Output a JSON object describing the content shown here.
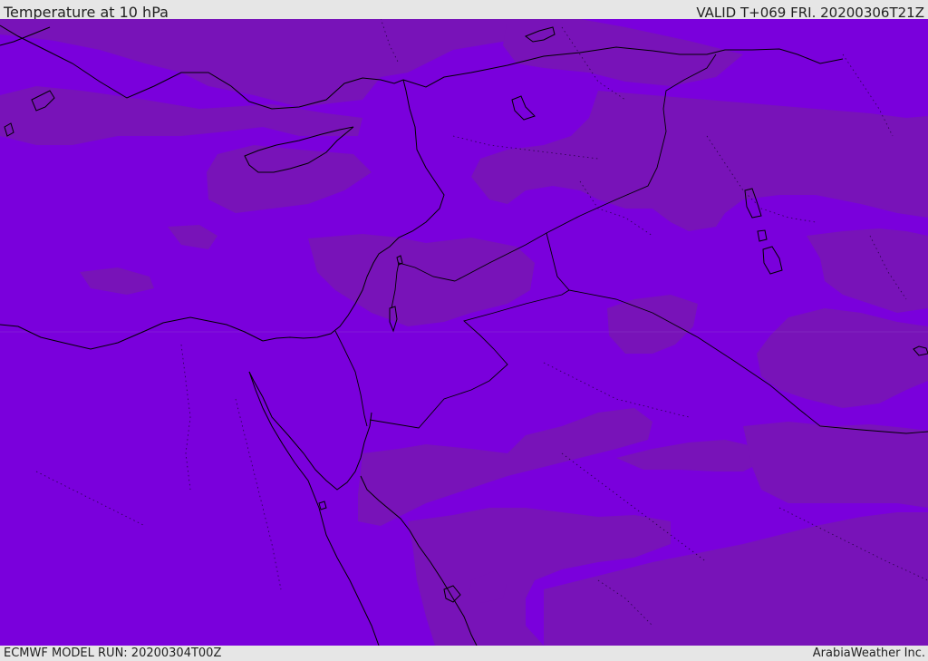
{
  "header": {
    "title": "Temperature at 10 hPa",
    "valid": "VALID T+069 FRI. 20200306T21Z"
  },
  "footer": {
    "model_run": "ECMWF MODEL RUN: 20200304T00Z",
    "credit": "ArabiaWeather Inc."
  },
  "map": {
    "field": "temperature",
    "level": "10 hPa",
    "colors": {
      "base": "#7a00dc",
      "shade": "#7813b8",
      "coast": "#000000",
      "border": "#000000"
    }
  }
}
